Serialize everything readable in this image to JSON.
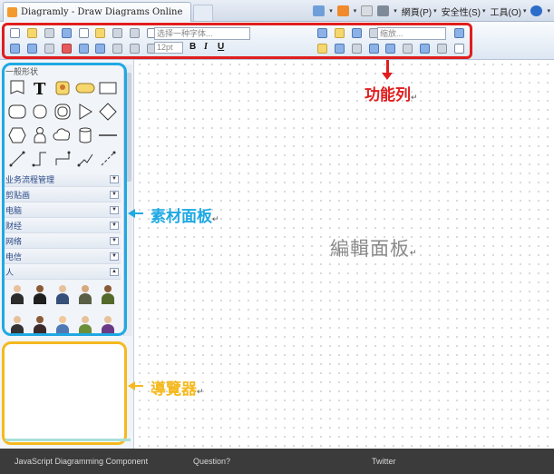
{
  "browser": {
    "tab_title": "Diagramly - Draw Diagrams Online",
    "commands": [
      {
        "label": "網頁(P)",
        "icon": "page-icon"
      },
      {
        "label": "安全性(S)",
        "icon": "safety-icon"
      },
      {
        "label": "工具(O)",
        "icon": "tools-icon"
      }
    ]
  },
  "toolbar": {
    "font_placeholder": "选择一种字体...",
    "size_value": "12pt",
    "zoom_placeholder": "缩放...",
    "bold": "B",
    "italic": "I",
    "underline": "U"
  },
  "sidebar": {
    "shapes_header": "一般形状",
    "categories": [
      "业务流程管理",
      "剪贴画",
      "电脑",
      "财经",
      "网络",
      "电信",
      "人"
    ]
  },
  "annotations": {
    "toolbar_label": "功能列",
    "materials_label": "素材面板",
    "editor_label": "編輯面板",
    "navigator_label": "導覽器",
    "return_mark": "↵",
    "toolbar_color": "#e01e1e",
    "materials_color": "#1fa9e3",
    "navigator_color": "#f5b91f"
  },
  "footer": {
    "links": [
      "JavaScript Diagramming Component",
      "Question?",
      "Twitter"
    ]
  }
}
